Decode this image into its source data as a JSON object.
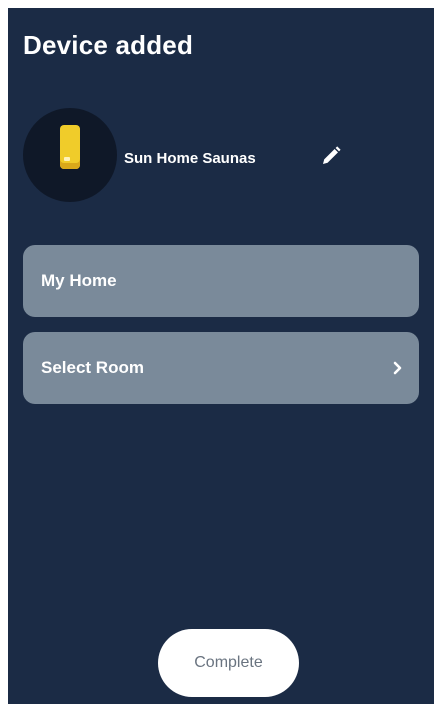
{
  "header": {
    "title": "Device added"
  },
  "device": {
    "name": "Sun Home Saunas",
    "icon": "device-icon",
    "icon_color": "#f0cc2a"
  },
  "rows": [
    {
      "label": "My Home"
    },
    {
      "label": "Select Room",
      "icon": "chevron-right-icon"
    }
  ],
  "actions": {
    "complete_label": "Complete"
  },
  "colors": {
    "background": "#1b2b45",
    "row_background": "#7a8a9a",
    "button_background": "#ffffff"
  }
}
